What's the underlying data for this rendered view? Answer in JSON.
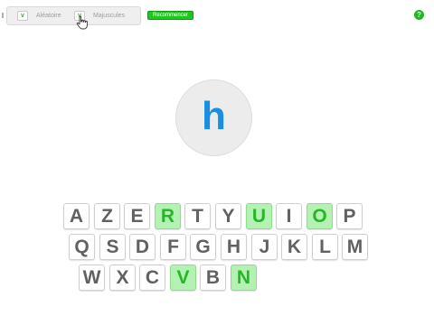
{
  "options": {
    "random": {
      "label": "Aléatoire",
      "checked": true,
      "check_glyph": "v"
    },
    "uppercase": {
      "label": "Majuscules",
      "checked": true,
      "check_glyph": "v"
    }
  },
  "toolbar": {
    "restart_label": "Recommencer"
  },
  "help": {
    "glyph": "?",
    "icon": "help-icon"
  },
  "target": {
    "letter": "h"
  },
  "colors": {
    "accent_green": "#1fc71f",
    "highlight_key_bg": "#b3f2b3",
    "highlight_key_text": "#27b627",
    "target_letter": "#1a8fe0"
  },
  "keyboard": {
    "row1": [
      {
        "label": "A",
        "highlighted": false
      },
      {
        "label": "Z",
        "highlighted": false
      },
      {
        "label": "E",
        "highlighted": false
      },
      {
        "label": "R",
        "highlighted": true
      },
      {
        "label": "T",
        "highlighted": false
      },
      {
        "label": "Y",
        "highlighted": false
      },
      {
        "label": "U",
        "highlighted": true
      },
      {
        "label": "I",
        "highlighted": false
      },
      {
        "label": "O",
        "highlighted": true
      },
      {
        "label": "P",
        "highlighted": false
      }
    ],
    "row2": [
      {
        "label": "Q",
        "highlighted": false
      },
      {
        "label": "S",
        "highlighted": false
      },
      {
        "label": "D",
        "highlighted": false
      },
      {
        "label": "F",
        "highlighted": false
      },
      {
        "label": "G",
        "highlighted": false
      },
      {
        "label": "H",
        "highlighted": false
      },
      {
        "label": "J",
        "highlighted": false
      },
      {
        "label": "K",
        "highlighted": false
      },
      {
        "label": "L",
        "highlighted": false
      },
      {
        "label": "M",
        "highlighted": false
      }
    ],
    "row3": [
      {
        "label": "W",
        "highlighted": false
      },
      {
        "label": "X",
        "highlighted": false
      },
      {
        "label": "C",
        "highlighted": false
      },
      {
        "label": "V",
        "highlighted": true
      },
      {
        "label": "B",
        "highlighted": false
      },
      {
        "label": "N",
        "highlighted": true
      }
    ]
  }
}
